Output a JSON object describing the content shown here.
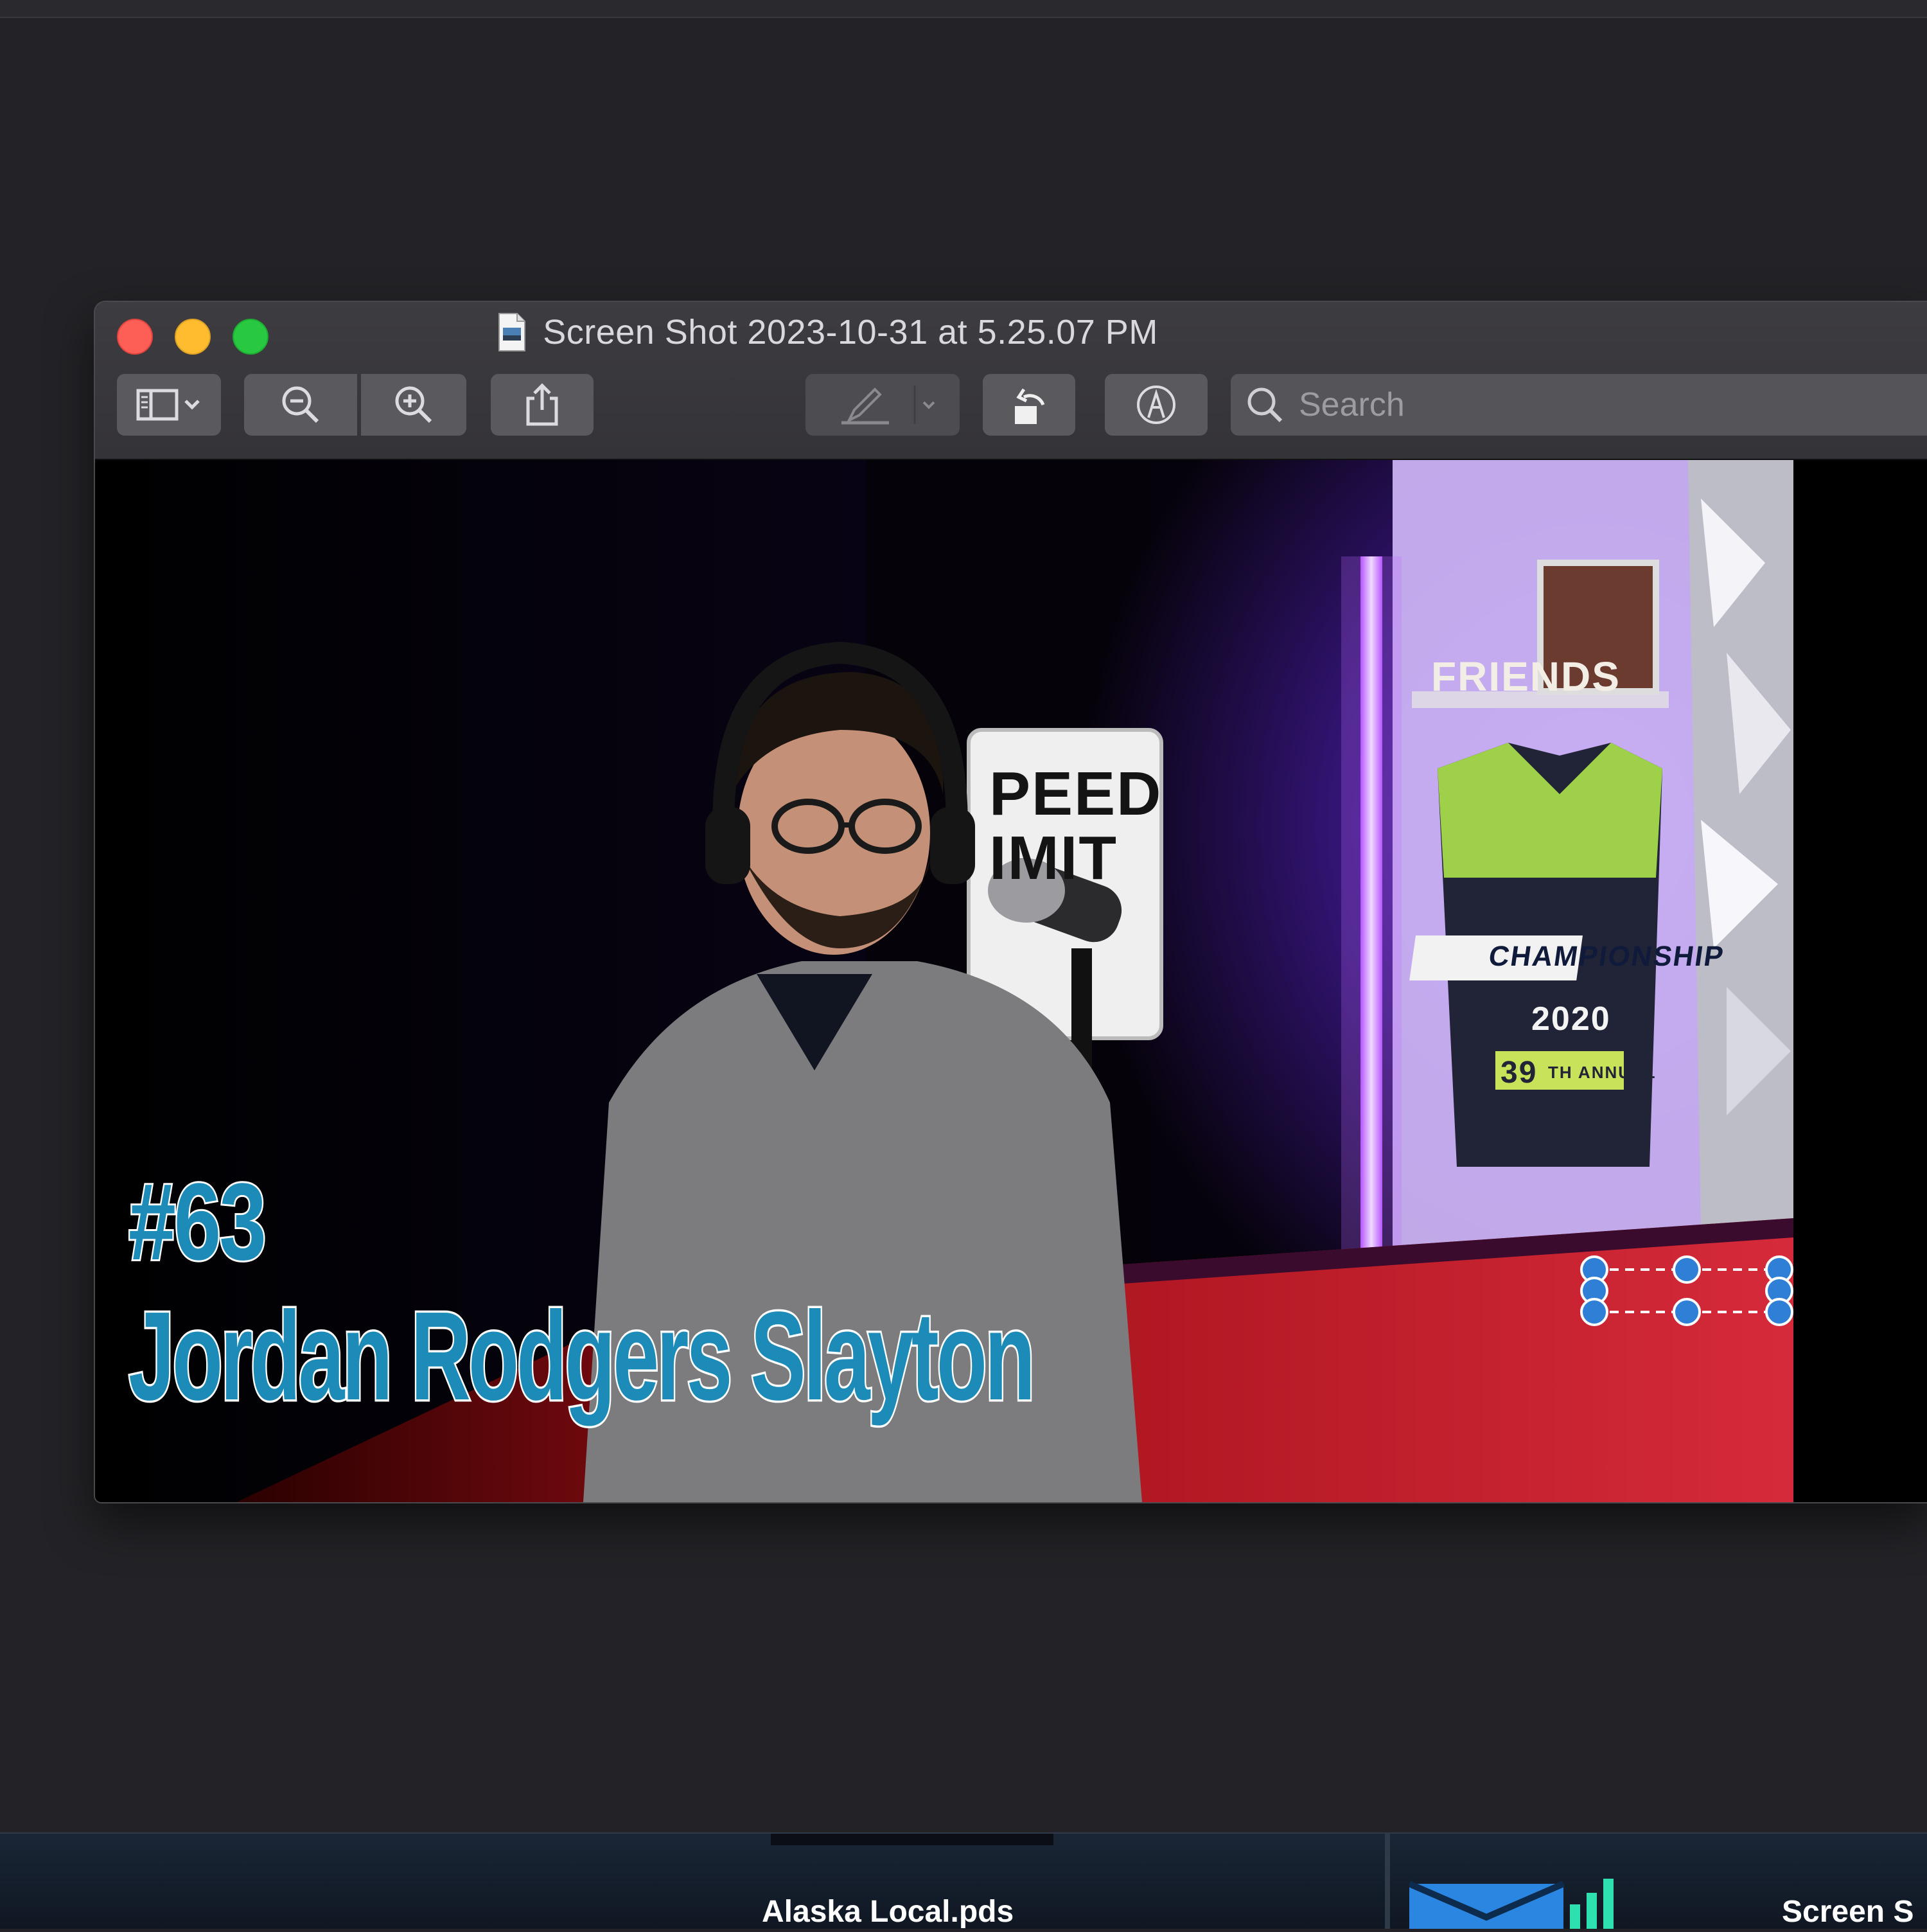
{
  "window": {
    "title": "Screen Shot 2023-10-31 at 5.25.07 PM"
  },
  "toolbar": {
    "search_placeholder": "Search",
    "buttons": [
      {
        "name": "sidebar-toggle",
        "icon": "sidebar-icon"
      },
      {
        "name": "zoom-out",
        "icon": "zoom-out-icon"
      },
      {
        "name": "zoom-in",
        "icon": "zoom-in-icon"
      },
      {
        "name": "share",
        "icon": "share-icon"
      },
      {
        "name": "highlight",
        "icon": "pen-icon"
      },
      {
        "name": "rotate",
        "icon": "rotate-icon"
      },
      {
        "name": "markup",
        "icon": "markup-icon"
      }
    ]
  },
  "image": {
    "episode_number": "#63",
    "guest_name": "Jordan Rodgers Slayton",
    "sign_text": "PEED IMIT",
    "shelf_sign": "FRIENDS",
    "jersey": {
      "heading": "CHAMPIONSHIP",
      "year": "2020",
      "number": "39",
      "sub": "TH ANNUAL"
    },
    "accent_colors": {
      "title_text": "#1d8bb8",
      "selection_handle": "#2f7fd6"
    }
  },
  "dock": {
    "items": [
      {
        "label": "Alaska Local.pds"
      },
      {
        "label": "Screen S"
      }
    ]
  }
}
